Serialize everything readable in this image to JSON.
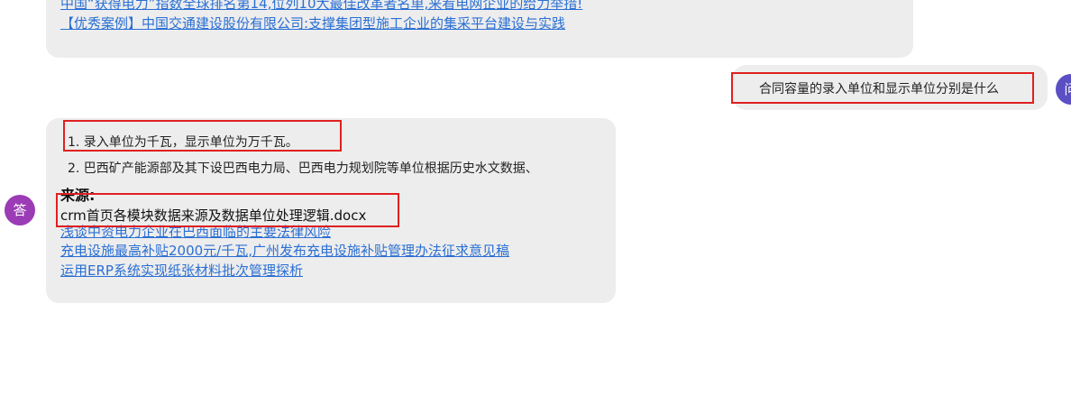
{
  "colors": {
    "bubble_bg": "#ededed",
    "link": "#2a6fd4",
    "highlight": "#e02020",
    "answer_avatar": "#9b3bb5",
    "user_avatar": "#5b4fc4"
  },
  "previous_answer": {
    "links": [
      "中国“获得电力”指数全球排名第14,位列10大最佳改革者名单,来看电网企业的给力举措!",
      "【优秀案例】中国交通建设股份有限公司:支撑集团型施工企业的集采平台建设与实践"
    ]
  },
  "user_message": {
    "text": "合同容量的录入单位和显示单位分别是什么",
    "avatar_text": "问",
    "avatar_icon": "user-question-avatar"
  },
  "answer": {
    "avatar_text": "答",
    "avatar_icon": "assistant-answer-avatar",
    "lines": [
      "1. 录入单位为千瓦，显示单位为万千瓦。",
      "2. 巴西矿产能源部及其下设巴西电力局、巴西电力规划院等单位根据历史水文数据、"
    ],
    "source_title": "来源:",
    "source_file": "crm首页各模块数据来源及数据单位处理逻辑.docx",
    "related_links": [
      "浅谈中资电力企业在巴西面临的主要法律风险",
      "充电设施最高补贴2000元/千瓦,广州发布充电设施补贴管理办法征求意见稿",
      "运用ERP系统实现纸张材料批次管理探析"
    ]
  }
}
